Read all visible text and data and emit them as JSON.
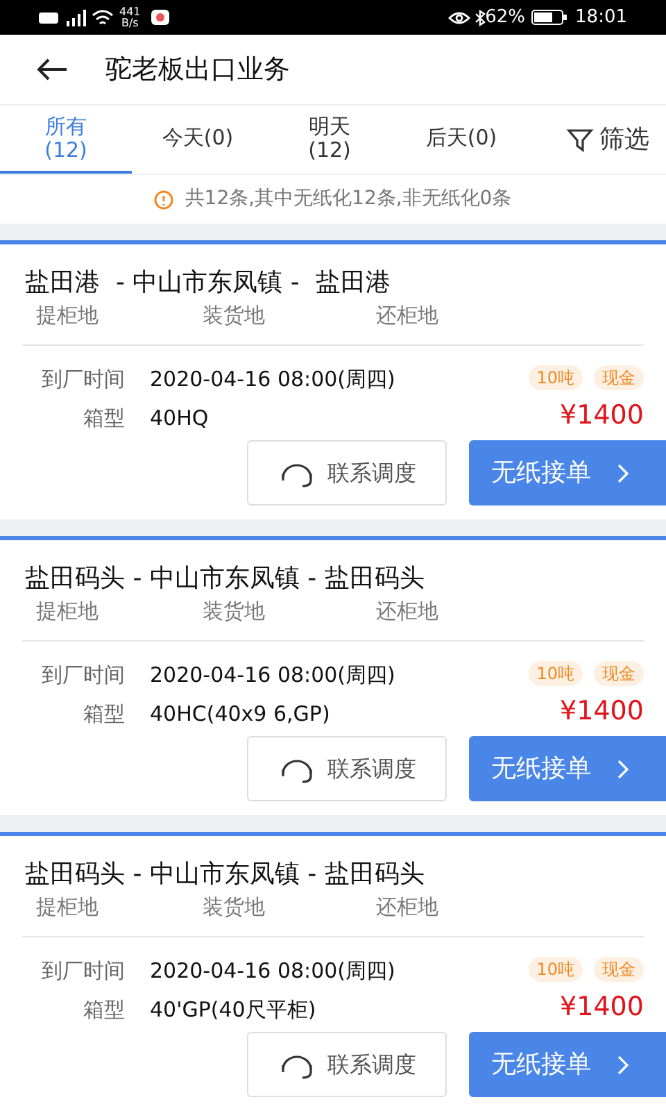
{
  "status_bar": {
    "speed": "441",
    "speed_unit": "B/s",
    "battery": "62%",
    "time": "18:01"
  },
  "header": {
    "title": "驼老板出口业务"
  },
  "tabs": [
    {
      "label": "所有",
      "count": "(12)",
      "selected": true
    },
    {
      "label": "今天(0)",
      "selected": false
    },
    {
      "label": "明天",
      "count": "(12)",
      "selected": false
    },
    {
      "label": "后天(0)",
      "selected": false
    }
  ],
  "filter": {
    "label": "筛选"
  },
  "notice": "共12条,其中无纸化12条,非无纸化0条",
  "orders": [
    {
      "route": "盐田港  - 中山市东凤镇 -  盐田港",
      "place_labels": [
        "提柜地",
        "装货地",
        "还柜地"
      ],
      "time_label": "到厂时间",
      "time": "2020-04-16 08:00(周四)",
      "type_label": "箱型",
      "container": "40HQ",
      "tags": [
        "10吨",
        "现金"
      ],
      "price": "¥1400",
      "contact_button": "联系调度",
      "accept_button": "无纸接单"
    },
    {
      "route": "盐田码头 - 中山市东凤镇 - 盐田码头",
      "place_labels": [
        "提柜地",
        "装货地",
        "还柜地"
      ],
      "time_label": "到厂时间",
      "time": "2020-04-16 08:00(周四)",
      "type_label": "箱型",
      "container": "40HC(40x9 6,GP)",
      "tags": [
        "10吨",
        "现金"
      ],
      "price": "¥1400",
      "contact_button": "联系调度",
      "accept_button": "无纸接单"
    },
    {
      "route": "盐田码头 - 中山市东凤镇 - 盐田码头",
      "place_labels": [
        "提柜地",
        "装货地",
        "还柜地"
      ],
      "time_label": "到厂时间",
      "time": "2020-04-16 08:00(周四)",
      "type_label": "箱型",
      "container": "40'GP(40尺平柜)",
      "tags": [
        "10吨",
        "现金"
      ],
      "price": "¥1400",
      "contact_button": "联系调度",
      "accept_button": "无纸接单"
    }
  ]
}
